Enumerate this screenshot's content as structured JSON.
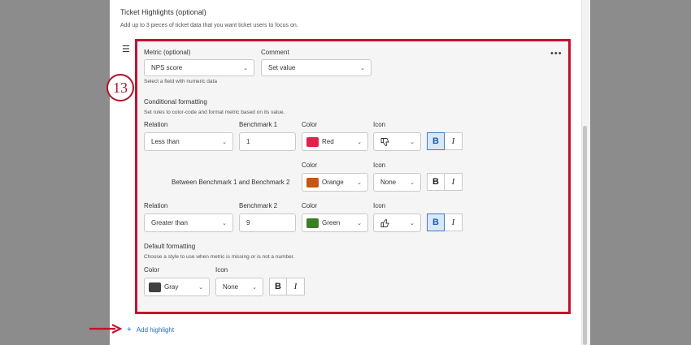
{
  "section": {
    "title": "Ticket Highlights (optional)",
    "description": "Add up to 3 pieces of ticket data that you want ticket users to focus on."
  },
  "step_number": "13",
  "metric": {
    "label": "Metric (optional)",
    "value": "NPS score",
    "hint": "Select a field with numeric data"
  },
  "comment": {
    "label": "Comment",
    "value": "Set value"
  },
  "conditional": {
    "title": "Conditional formatting",
    "description": "Set rules to color-code and format metric based on its value.",
    "rows": [
      {
        "relation_label": "Relation",
        "relation": "Less than",
        "benchmark_label": "Benchmark 1",
        "benchmark": "1",
        "color_label": "Color",
        "color": "Red",
        "swatch": "#e0234a",
        "icon_label": "Icon",
        "icon": "thumbs-down-icon",
        "bold": true,
        "italic": false
      },
      {
        "between_label": "Between Benchmark 1 and Benchmark 2",
        "color_label": "Color",
        "color": "Orange",
        "swatch": "#c9540e",
        "icon_label": "Icon",
        "icon": "None",
        "bold": false,
        "italic": false
      },
      {
        "relation_label": "Relation",
        "relation": "Greater than",
        "benchmark_label": "Benchmark 2",
        "benchmark": "9",
        "color_label": "Color",
        "color": "Green",
        "swatch": "#3b7d23",
        "icon_label": "Icon",
        "icon": "thumbs-up-icon",
        "bold": true,
        "italic": false
      }
    ]
  },
  "default_formatting": {
    "title": "Default formatting",
    "description": "Choose a style to use when metric is missing or is not a number.",
    "color_label": "Color",
    "color": "Gray",
    "swatch": "#404040",
    "icon_label": "Icon",
    "icon": "None"
  },
  "format_glyphs": {
    "bold": "B",
    "italic": "I"
  },
  "add_highlight": "Add highlight",
  "colors": {
    "accent_red": "#c8102e",
    "link_blue": "#1f6fbf",
    "active_blue": "#3d7ec4"
  }
}
